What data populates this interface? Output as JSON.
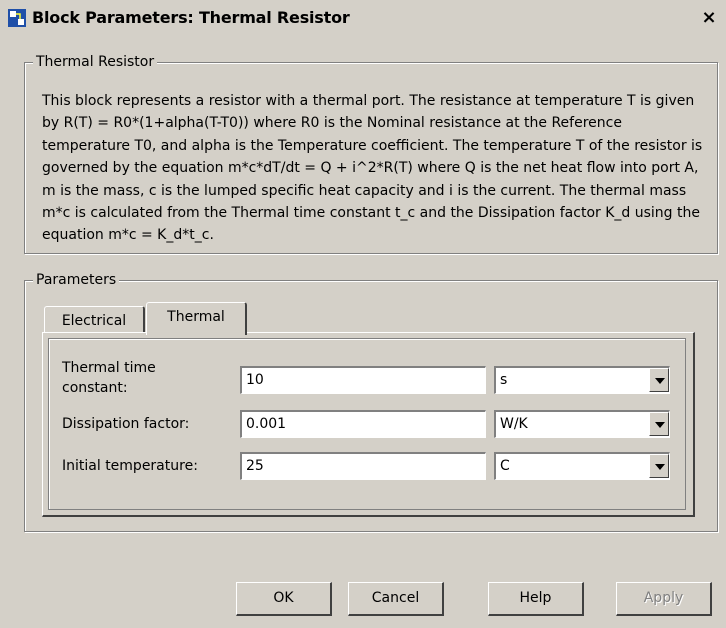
{
  "window": {
    "title": "Block Parameters: Thermal Resistor",
    "close_glyph": "×"
  },
  "description_group": {
    "legend": "Thermal Resistor",
    "text": "This block represents a resistor with a thermal port. The resistance at temperature T is given by R(T) = R0*(1+alpha(T-T0)) where R0 is the Nominal resistance at the Reference temperature T0, and alpha is the Temperature coefficient. The temperature T of the resistor is governed by the equation m*c*dT/dt = Q + i^2*R(T) where Q is the net heat flow into port A, m is the mass, c is the lumped specific heat capacity and i is the current. The thermal mass m*c is calculated from the Thermal time constant t_c and the Dissipation factor K_d using the equation m*c = K_d*t_c."
  },
  "parameters_group": {
    "legend": "Parameters",
    "tabs": [
      {
        "label": "Electrical",
        "active": false
      },
      {
        "label": "Thermal",
        "active": true
      }
    ],
    "rows": [
      {
        "label_line1": "Thermal time",
        "label_line2": "constant:",
        "value": "10",
        "unit": "s"
      },
      {
        "label": "Dissipation factor:",
        "value": "0.001",
        "unit": "W/K"
      },
      {
        "label": "Initial temperature:",
        "value": "25",
        "unit": "C"
      }
    ]
  },
  "buttons": {
    "ok": "OK",
    "cancel": "Cancel",
    "help": "Help",
    "apply": "Apply"
  },
  "icons": {
    "title": "simulink-block-icon",
    "dropdown": "chevron-down-icon"
  }
}
